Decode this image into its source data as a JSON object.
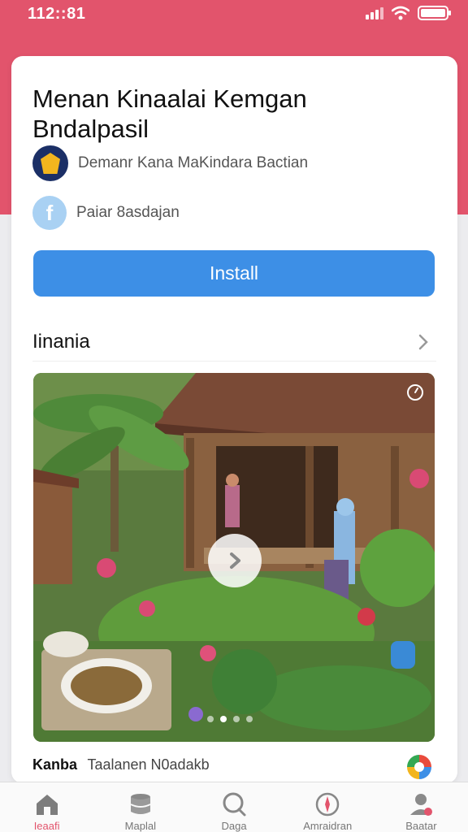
{
  "status_bar": {
    "time": "112::81"
  },
  "app": {
    "title": "Menan Kinaalai Kemgan Bndalpasil",
    "developer": "Demanr Kana MaKindara Bactian",
    "publisher": "Paiar 8asdajan",
    "install_label": "Install"
  },
  "section": {
    "title": "Iinania"
  },
  "media": {
    "slide_count": 4,
    "active_slide": 2
  },
  "caption": {
    "label": "Kanba",
    "text": "Taalanen N0adakb"
  },
  "nav": {
    "items": [
      {
        "label": "Ieaafi",
        "icon": "home-icon",
        "active": true
      },
      {
        "label": "Maplal",
        "icon": "database-icon",
        "active": false
      },
      {
        "label": "Daga",
        "icon": "search-icon",
        "active": false
      },
      {
        "label": "Amraidran",
        "icon": "compass-icon",
        "active": false
      },
      {
        "label": "Baatar",
        "icon": "profile-icon",
        "active": false
      }
    ]
  },
  "colors": {
    "brand": "#e2546c",
    "install": "#3d8fe6"
  }
}
